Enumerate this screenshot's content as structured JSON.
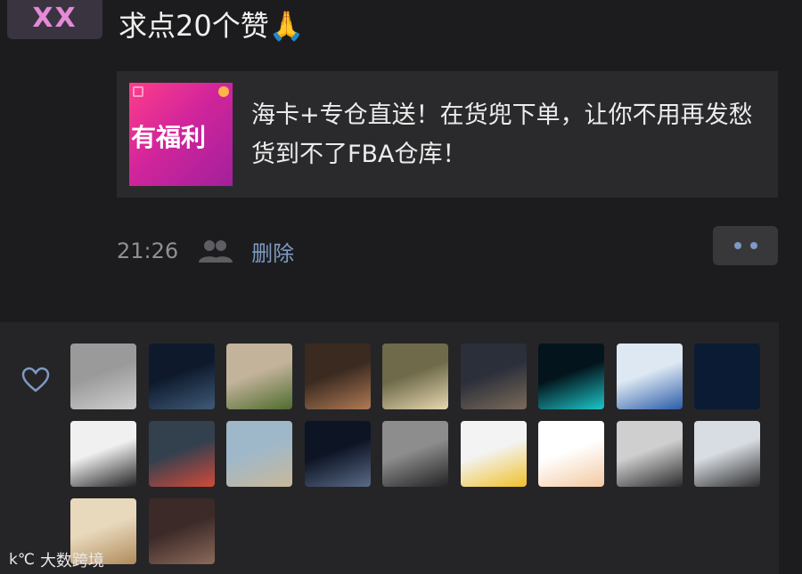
{
  "post": {
    "avatar_text": "XX",
    "text": "求点20个赞🙏",
    "share": {
      "thumb_text": "有福利",
      "title": "海卡+专仓直送！在货兜下单，让你不用再发愁货到不了FBA仓库！"
    },
    "time": "21:26",
    "delete_label": "删除",
    "more_icon": "more-dots-icon",
    "visibility_icon": "people-icon"
  },
  "likes": {
    "icon": "heart-icon",
    "avatars": [
      {
        "name": "liker-avatar-1",
        "c1": "#9a9a9a",
        "c2": "#cfcfcf"
      },
      {
        "name": "liker-avatar-2",
        "c1": "#0e1a2c",
        "c2": "#3f5a78"
      },
      {
        "name": "liker-avatar-3",
        "c1": "#c2b39a",
        "c2": "#4f6b2e"
      },
      {
        "name": "liker-avatar-4",
        "c1": "#3a2a20",
        "c2": "#b07a55"
      },
      {
        "name": "liker-avatar-5",
        "c1": "#6e6a4a",
        "c2": "#e7d7b0"
      },
      {
        "name": "liker-avatar-6",
        "c1": "#2a2f3a",
        "c2": "#7c6a5a"
      },
      {
        "name": "liker-avatar-7",
        "c1": "#04141c",
        "c2": "#1cc7c9"
      },
      {
        "name": "liker-avatar-8",
        "c1": "#dde8f2",
        "c2": "#2b5ca8"
      },
      {
        "name": "liker-avatar-9",
        "c1": "#0b1b33",
        "c2": "#0b1b33"
      },
      {
        "name": "liker-avatar-10",
        "c1": "#f0f0f0",
        "c2": "#222222"
      },
      {
        "name": "liker-avatar-11",
        "c1": "#33404e",
        "c2": "#d24a3a"
      },
      {
        "name": "liker-avatar-12",
        "c1": "#9fb8c9",
        "c2": "#c9b89a"
      },
      {
        "name": "liker-avatar-13",
        "c1": "#0d1424",
        "c2": "#5a6a88"
      },
      {
        "name": "liker-avatar-14",
        "c1": "#8d8d8d",
        "c2": "#222222"
      },
      {
        "name": "liker-avatar-15",
        "c1": "#f3f3f3",
        "c2": "#f0c02a"
      },
      {
        "name": "liker-avatar-16",
        "c1": "#ffffff",
        "c2": "#f3c8a0"
      },
      {
        "name": "liker-avatar-17",
        "c1": "#cfcfcf",
        "c2": "#2a2a2a"
      },
      {
        "name": "liker-avatar-18",
        "c1": "#d8dde3",
        "c2": "#2c2c2c"
      },
      {
        "name": "liker-avatar-19",
        "c1": "#e8d9bd",
        "c2": "#b08a5a"
      },
      {
        "name": "liker-avatar-20",
        "c1": "#3c2a28",
        "c2": "#8c6a5a"
      }
    ]
  },
  "watermark": {
    "logo": "k℃",
    "text": "大数跨境"
  }
}
